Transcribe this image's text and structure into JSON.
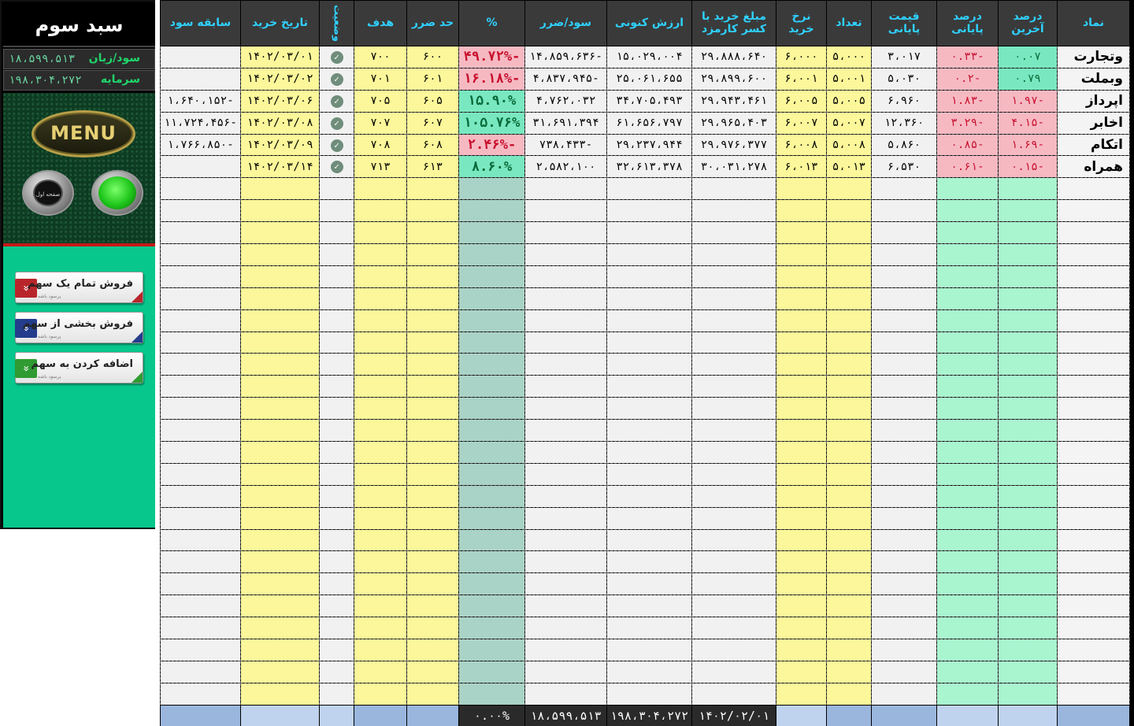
{
  "side": {
    "title": "سبد سوم",
    "profit_label": "سود/زیان",
    "profit_value": "۱۸،۵۹۹،۵۱۳",
    "capital_label": "سرمایه",
    "capital_value": "۱۹۸،۳۰۴،۲۷۲",
    "menu_label": "MENU",
    "home_label": "صفحه اول",
    "actions": [
      {
        "label": "فروش تمام یک سهم",
        "sub": "پرسود باشه",
        "color": "#b8262b",
        "corner": "#b8262b",
        "icon": "chevron-down-icon"
      },
      {
        "label": "فروش بخشی از سهم",
        "sub": "پرسود باشه",
        "color": "#233c8c",
        "corner": "#233c8c",
        "icon": "chevron-down-icon"
      },
      {
        "label": "اضافه کردن به سهم",
        "sub": "پرسود باشه",
        "color": "#2f9b32",
        "corner": "#2f9b32",
        "icon": "chevron-down-icon"
      }
    ]
  },
  "table": {
    "headers": [
      "نماد",
      "درصد آخرین",
      "درصد پایانی",
      "قیمت پایانی",
      "تعداد",
      "نرخ خرید",
      "مبلغ خرید با کسر کارمزد",
      "ارزش کنونی",
      "سود/ضرر",
      "%",
      "حد ضرر",
      "هدف",
      "وضعیت",
      "تاریخ خرید",
      "سابقه سود"
    ],
    "rows": [
      {
        "sym": "وتجارت",
        "last_pct": "۰.۰۷",
        "close_pct": "-۰.۳۳",
        "close_price": "۳،۰۱۷",
        "qty": "۵،۰۰۰",
        "buy_rate": "۶،۰۰۰",
        "buy_amount": "۲۹،۸۸۸،۶۴۰",
        "value": "۱۵،۰۲۹،۰۰۴",
        "pnl": "-۱۴،۸۵۹،۶۳۶",
        "pct": "-۴۹.۷۲%",
        "pct_sign": "neg",
        "stop": "۶۰۰",
        "target": "۷۰۰",
        "status": "✓",
        "date": "۱۴۰۲/۰۳/۰۱",
        "history": "",
        "last_sign": "pos",
        "close_sign": "neg"
      },
      {
        "sym": "وبملت",
        "last_pct": "۰.۷۹",
        "close_pct": "-۰.۲",
        "close_price": "۵،۰۳۰",
        "qty": "۵،۰۰۱",
        "buy_rate": "۶،۰۰۱",
        "buy_amount": "۲۹،۸۹۹،۶۰۰",
        "value": "۲۵،۰۶۱،۶۵۵",
        "pnl": "-۴،۸۳۷،۹۴۵",
        "pct": "-۱۶.۱۸%",
        "pct_sign": "neg",
        "stop": "۶۰۱",
        "target": "۷۰۱",
        "status": "✓",
        "date": "۱۴۰۲/۰۳/۰۲",
        "history": "",
        "last_sign": "pos",
        "close_sign": "neg"
      },
      {
        "sym": "اپرداز",
        "last_pct": "-۱.۹۷",
        "close_pct": "-۱.۸۳",
        "close_price": "۶،۹۶۰",
        "qty": "۵،۰۰۵",
        "buy_rate": "۶،۰۰۵",
        "buy_amount": "۲۹،۹۴۳،۴۶۱",
        "value": "۳۴،۷۰۵،۴۹۳",
        "pnl": "۴،۷۶۲،۰۳۲",
        "pct": "۱۵.۹۰%",
        "pct_sign": "pos",
        "stop": "۶۰۵",
        "target": "۷۰۵",
        "status": "✓",
        "date": "۱۴۰۲/۰۳/۰۶",
        "history": "-۱،۶۴۰،۱۵۲",
        "last_sign": "neg",
        "close_sign": "neg"
      },
      {
        "sym": "اخابر",
        "last_pct": "-۴.۱۵",
        "close_pct": "-۳.۲۹",
        "close_price": "۱۲،۳۶۰",
        "qty": "۵،۰۰۷",
        "buy_rate": "۶،۰۰۷",
        "buy_amount": "۲۹،۹۶۵،۴۰۳",
        "value": "۶۱،۶۵۶،۷۹۷",
        "pnl": "۳۱،۶۹۱،۳۹۴",
        "pct": "۱۰۵.۷۶%",
        "pct_sign": "pos",
        "stop": "۶۰۷",
        "target": "۷۰۷",
        "status": "✓",
        "date": "۱۴۰۲/۰۳/۰۸",
        "history": "-۱۱،۷۲۴،۴۵۶",
        "last_sign": "neg",
        "close_sign": "neg"
      },
      {
        "sym": "اتکام",
        "last_pct": "-۱.۶۹",
        "close_pct": "-۰.۸۵",
        "close_price": "۵،۸۶۰",
        "qty": "۵،۰۰۸",
        "buy_rate": "۶،۰۰۸",
        "buy_amount": "۲۹،۹۷۶،۳۷۷",
        "value": "۲۹،۲۳۷،۹۴۴",
        "pnl": "-۷۳۸،۴۳۳",
        "pct": "-۲.۴۶%",
        "pct_sign": "neg",
        "stop": "۶۰۸",
        "target": "۷۰۸",
        "status": "✓",
        "date": "۱۴۰۲/۰۳/۰۹",
        "history": "-۱،۷۶۶،۸۵۰",
        "last_sign": "neg",
        "close_sign": "neg"
      },
      {
        "sym": "همراه",
        "last_pct": "-۰.۱۵",
        "close_pct": "-۰.۶۱",
        "close_price": "۶،۵۳۰",
        "qty": "۵،۰۱۳",
        "buy_rate": "۶،۰۱۳",
        "buy_amount": "۳۰،۰۳۱،۲۷۸",
        "value": "۳۲،۶۱۳،۳۷۸",
        "pnl": "۲،۵۸۲،۱۰۰",
        "pct": "۸.۶۰%",
        "pct_sign": "pos",
        "stop": "۶۱۳",
        "target": "۷۱۳",
        "status": "✓",
        "date": "۱۴۰۲/۰۳/۱۴",
        "history": "",
        "last_sign": "neg",
        "close_sign": "neg"
      }
    ],
    "empty_rows": 24,
    "footer": {
      "pct": "۰.۰۰%",
      "pnl": "۱۸،۵۹۹،۵۱۳",
      "value": "۱۹۸،۳۰۴،۲۷۲",
      "date": "۱۴۰۲/۰۲/۰۱"
    }
  }
}
